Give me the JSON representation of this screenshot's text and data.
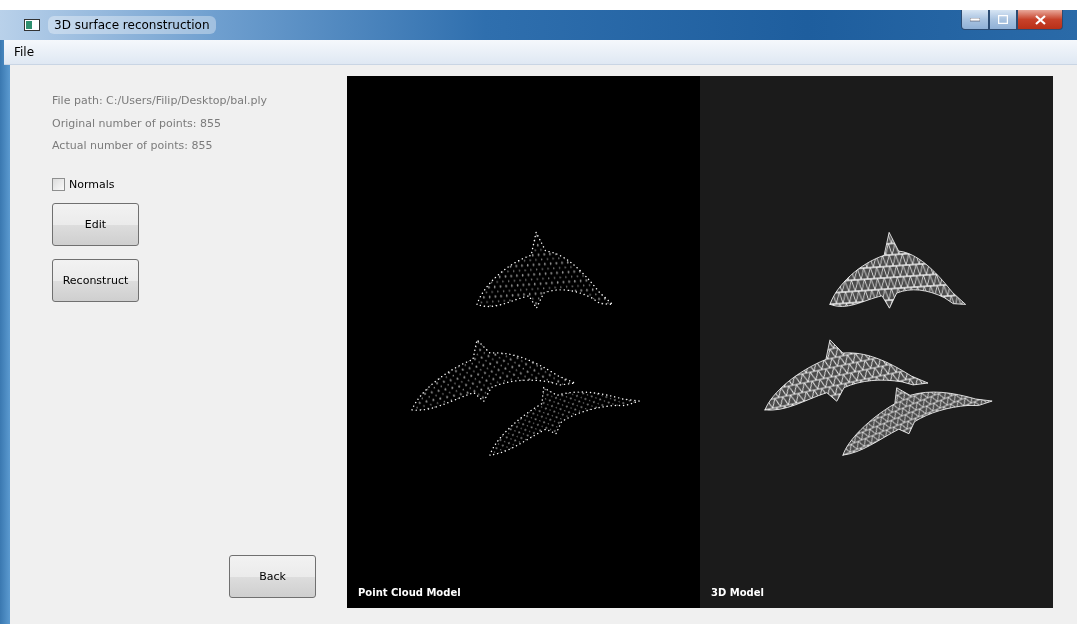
{
  "window": {
    "title": "3D surface reconstruction"
  },
  "menu": [
    {
      "label": "File"
    }
  ],
  "info": [
    "File path: C:/Users/Filip/Desktop/bal.ply",
    "Original number of points: 855",
    "Actual number of points: 855"
  ],
  "normals": {
    "label": "Normals",
    "checked": false
  },
  "actions": [
    {
      "label": "Edit"
    },
    {
      "label": "Reconstruct"
    }
  ],
  "back": {
    "label": "Back"
  },
  "viewports": [
    {
      "kind": "points",
      "label": "Point Cloud Model"
    },
    {
      "kind": "mesh",
      "label": "3D Model"
    }
  ]
}
